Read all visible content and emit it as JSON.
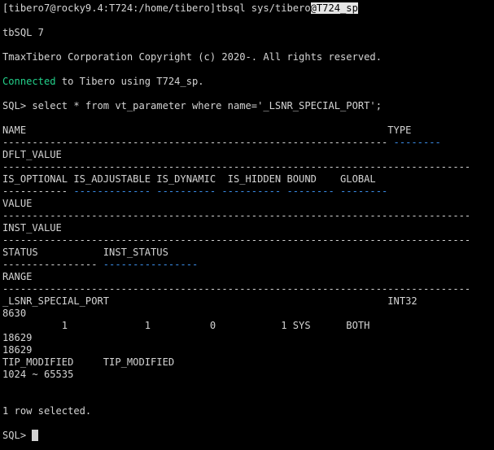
{
  "terminal": {
    "prompt_cmd_prefix": "[tibero7@rocky9.4:T724:/home/tibero]tbsql sys/tibero",
    "prompt_cmd_highlight": "@T724_sp",
    "banner_title": "tbSQL 7",
    "copyright": "TmaxTibero Corporation Copyright (c) 2020-. All rights reserved.",
    "connected_word": "Connected",
    "connected_rest": " to Tibero using T724_sp.",
    "query": "SQL> select * from vt_parameter where name='_LSNR_SPECIAL_PORT';",
    "hdr_name_type": "NAME                                                             TYPE",
    "dash_name": "-----------------------------------------------------------------",
    "dash_type": " --------",
    "hdr_dflt": "DFLT_VALUE",
    "dash_full": "-------------------------------------------------------------------------------",
    "hdr_flags": "IS_OPTIONAL IS_ADJUSTABLE IS_DYNAMIC  IS_HIDDEN BOUND    GLOBAL",
    "dash_flags_1": "-----------",
    "dash_flags_2": " ------------- ---------- ---------- -------- --------",
    "hdr_value": "VALUE",
    "hdr_inst_value": "INST_VALUE",
    "hdr_status": "STATUS           INST_STATUS",
    "dash_status_1": "----------------",
    "dash_status_2": " ----------------",
    "hdr_range": "RANGE",
    "row_name_type": "_LSNR_SPECIAL_PORT                                               INT32",
    "row_dflt": "8630",
    "row_flags": "          1             1          0           1 SYS      BOTH",
    "row_value": "18629",
    "row_inst_value": "18629",
    "row_status": "TIP_MODIFIED     TIP_MODIFIED",
    "row_range": "1024 ~ 65535",
    "rows_selected": "1 row selected.",
    "final_prompt": "SQL> "
  },
  "colors": {
    "background": "#000000",
    "text": "#d4d4d4",
    "green": "#23d18b",
    "blue_dash": "#3b8eea",
    "highlight_bg": "#e5e5e5"
  }
}
